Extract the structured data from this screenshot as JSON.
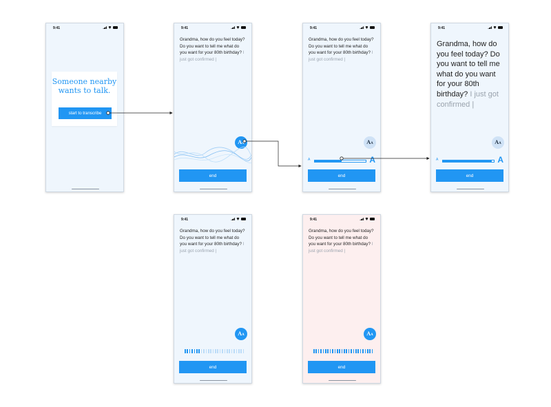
{
  "status": {
    "time": "9:41"
  },
  "intro": {
    "title": "Someone nearby wants to talk.",
    "start_label": "start to transcribe"
  },
  "transcript": {
    "final": "Grandma, how do you feel today? Do you want to tell me what do you want for your 80th birthday?",
    "interim": "I just got confirmed",
    "cursor": "|"
  },
  "controls": {
    "end_label": "end",
    "aa_label": "A",
    "aa_small": "A",
    "slider_small_label": "A",
    "slider_large_label": "A"
  },
  "slider": {
    "screen3_value": 0.5,
    "screen4_value": 0.93
  },
  "meters": {
    "screen5": {
      "total": 26,
      "active": 7
    },
    "screen6": {
      "total": 26,
      "active": 26
    }
  },
  "colors": {
    "accent": "#2196f3",
    "screen_bg": "#eff6fd",
    "alert_bg": "#fdefef",
    "aa_soft": "#cfe2f6"
  },
  "icons": [
    "cellular-signal-icon",
    "wifi-icon",
    "battery-icon",
    "text-size-icon",
    "sound-wave-icon"
  ]
}
